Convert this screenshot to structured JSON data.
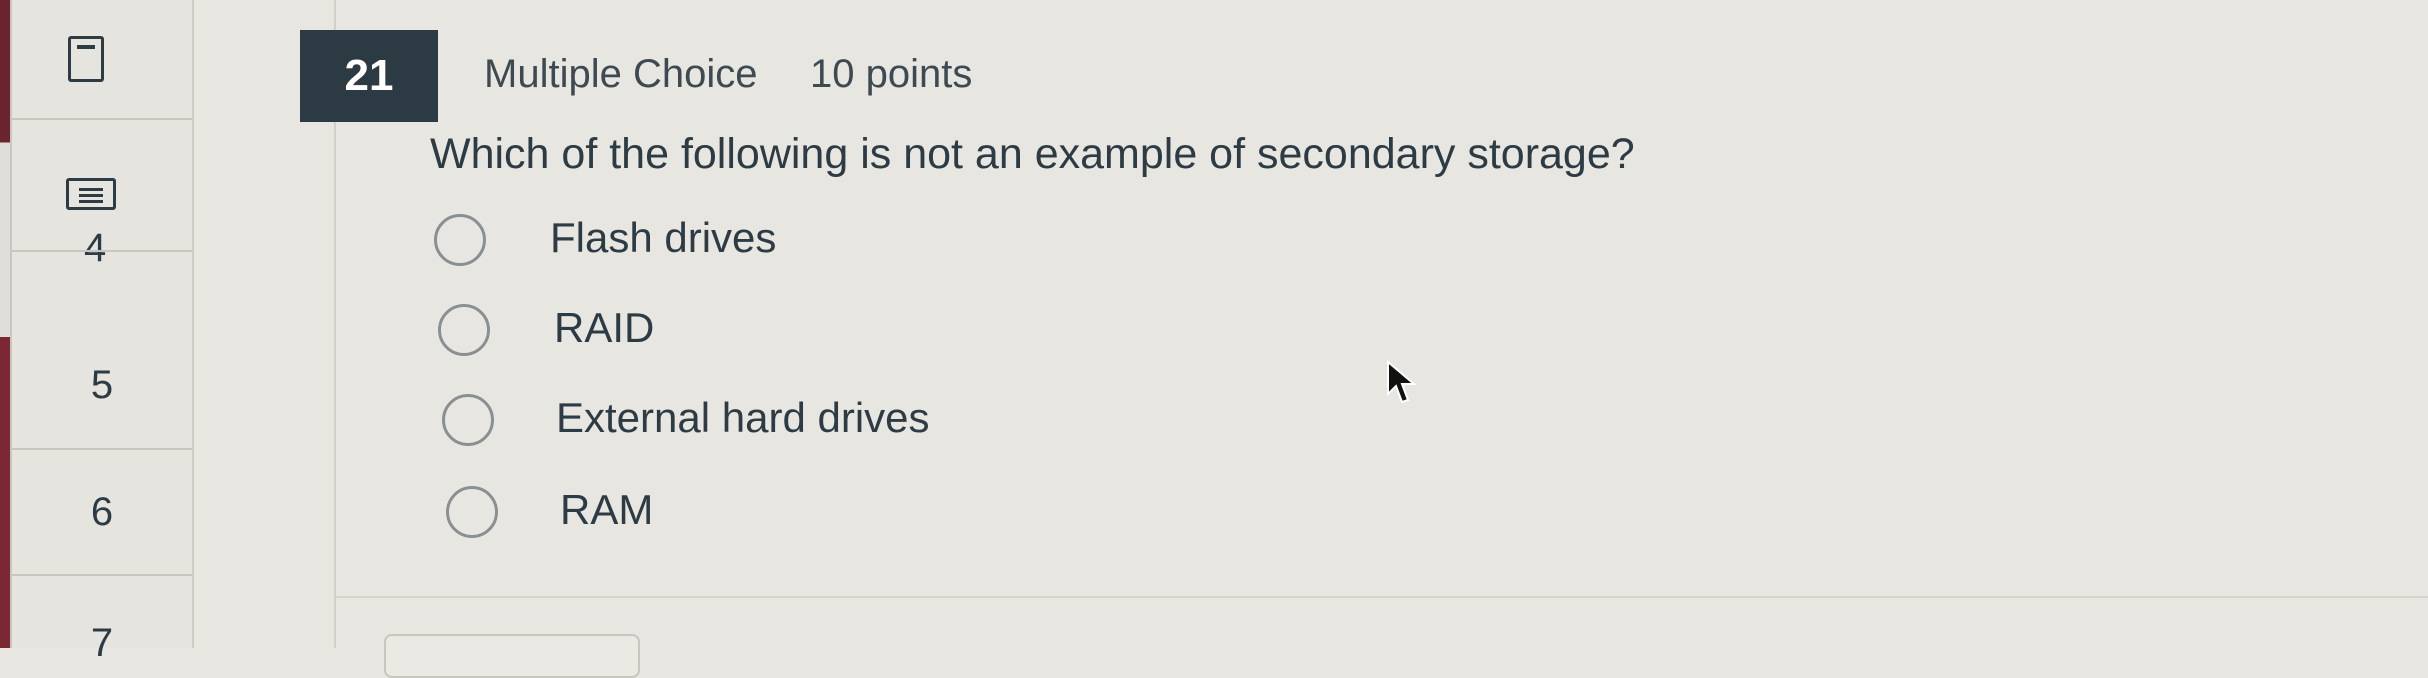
{
  "nav": {
    "items": [
      "4",
      "5",
      "6",
      "7"
    ]
  },
  "question": {
    "number": "21",
    "type": "Multiple Choice",
    "points": "10 points",
    "text": "Which of the following is not an example of secondary storage?",
    "options": [
      "Flash drives",
      "RAID",
      "External hard drives",
      "RAM"
    ]
  },
  "colors": {
    "question_number_bg": "#2c3a44",
    "left_accent": "#7b2734",
    "background": "#e8e6e1"
  }
}
